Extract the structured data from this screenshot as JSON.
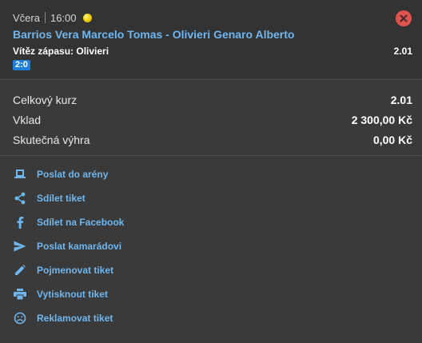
{
  "bet": {
    "day": "Včera",
    "time": "16:00",
    "match_title": "Barrios Vera Marcelo Tomas - Olivieri Genaro Alberto",
    "selection": "Vítěz zápasu: Olivieri",
    "odds": "2.01",
    "score": "2:0"
  },
  "summary": {
    "total_odds_label": "Celkový kurz",
    "total_odds_value": "2.01",
    "stake_label": "Vklad",
    "stake_value": "2 300,00 Kč",
    "actual_win_label": "Skutečná výhra",
    "actual_win_value": "0,00 Kč"
  },
  "actions": [
    {
      "label": "Poslat do arény",
      "icon": "arena-icon"
    },
    {
      "label": "Sdílet tiket",
      "icon": "share-icon"
    },
    {
      "label": "Sdílet na Facebook",
      "icon": "facebook-icon"
    },
    {
      "label": "Poslat kamarádovi",
      "icon": "send-icon"
    },
    {
      "label": "Pojmenovat tiket",
      "icon": "pencil-icon"
    },
    {
      "label": "Vytisknout tiket",
      "icon": "print-icon"
    },
    {
      "label": "Reklamovat tiket",
      "icon": "sad-face-icon"
    }
  ],
  "colors": {
    "link": "#6fb6ef",
    "lost_close": "#e0534f",
    "score_badge": "#1e7fd8",
    "background": "#3a3a3a"
  }
}
